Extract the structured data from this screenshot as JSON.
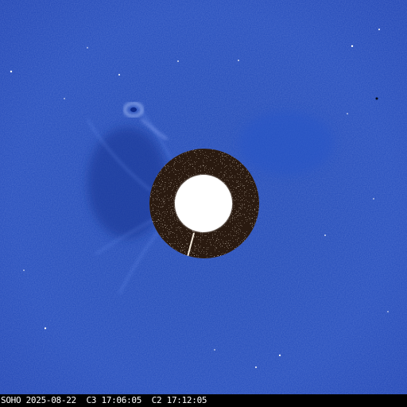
{
  "image": {
    "caption": "SOHO 2025-08-22  C3 17:06:05  C2 17:12:05"
  },
  "colors": {
    "background_blue": "#1e47b5",
    "occulter_brown": "#4a3020",
    "sun_disk": "#ffffff",
    "caption_bar": "#000000",
    "caption_text": "#ffffff"
  }
}
